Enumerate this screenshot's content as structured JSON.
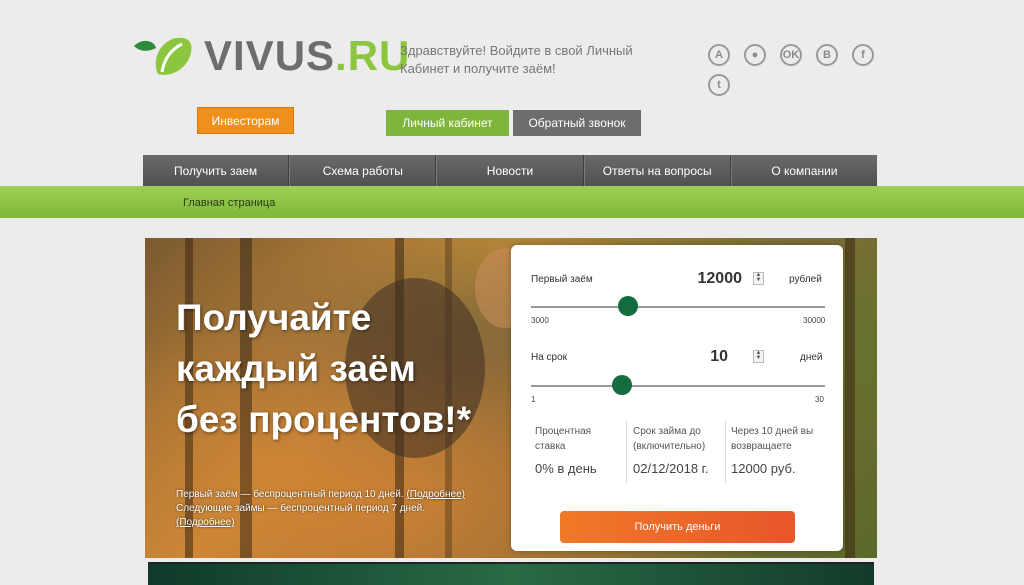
{
  "header": {
    "logo_main": "VIVUS",
    "logo_tld": ".RU",
    "greeting": "Здравствуйте! Войдите в свой Личный Кабинет и получите заём!",
    "social_icons": [
      {
        "name": "android-icon",
        "glyph": "A"
      },
      {
        "name": "apple-icon",
        "glyph": "●"
      },
      {
        "name": "odnoklassniki-icon",
        "glyph": "OK"
      },
      {
        "name": "vkontakte-icon",
        "glyph": "B"
      },
      {
        "name": "facebook-icon",
        "glyph": "f"
      },
      {
        "name": "twitter-icon",
        "glyph": "t"
      }
    ]
  },
  "buttons": {
    "investors": "Инвесторам",
    "cabinet": "Личный кабинет",
    "callback": "Обратный звонок"
  },
  "nav": {
    "items": [
      "Получить заем",
      "Схема работы",
      "Новости",
      "Ответы на вопросы",
      "О компании"
    ]
  },
  "breadcrumb": "Главная страница",
  "hero": {
    "title_lines": [
      "Получайте",
      "каждый заём",
      "без процентов!*"
    ],
    "note_line1": "Первый заём — беспроцентный период 10 дней. ",
    "note_link1": "(Подробнее)",
    "note_line2": "Следующие займы — беспроцентный период 7 дней. ",
    "note_link2": "(Подробнее)"
  },
  "calculator": {
    "amount": {
      "label": "Первый заём",
      "value": "12000",
      "unit": "рублей",
      "min": "3000",
      "max": "30000",
      "fraction": 0.33
    },
    "term": {
      "label": "На срок",
      "value": "10",
      "unit": "дней",
      "min": "1",
      "max": "30",
      "fraction": 0.31
    },
    "info": [
      {
        "label": "Процентная ставка",
        "value": "0% в день"
      },
      {
        "label": "Срок займа до (включительно)",
        "value": "02/12/2018 г."
      },
      {
        "label": "Через 10 дней вы возвращаете",
        "value": "12000 руб."
      }
    ],
    "submit": "Получить деньги"
  },
  "colors": {
    "brand_green": "#8cc63f",
    "slider_knob": "#136d3e",
    "cta_orange": "#f07a28",
    "investors_orange": "#f0901c"
  }
}
